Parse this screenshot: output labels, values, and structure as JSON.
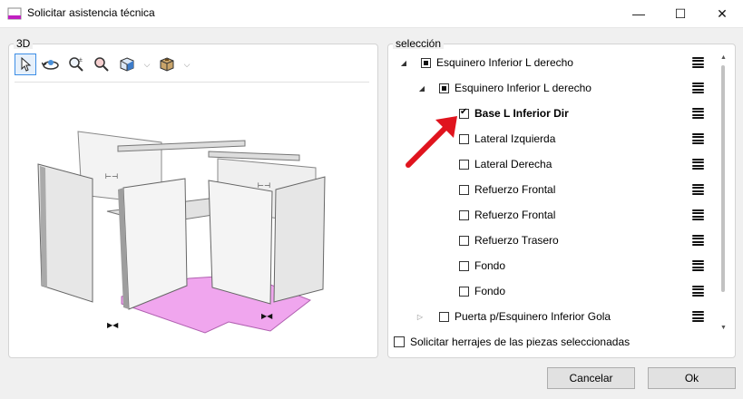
{
  "window": {
    "title": "Solicitar asistencia técnica",
    "minimize": "—",
    "maximize": "☐",
    "close": "✕"
  },
  "viewer": {
    "label": "3D",
    "tools": [
      "select-arrow-icon",
      "rotate-icon",
      "zoom-plus-minus-icon",
      "zoom-fit-icon",
      "view-cube-icon",
      "box-icon"
    ]
  },
  "selection": {
    "label": "selección",
    "items": [
      {
        "label": "Esquinero Inferior L derecho",
        "state": "indeterminate",
        "expander": "◢",
        "bold": false
      },
      {
        "label": "Esquinero Inferior L derecho",
        "state": "indeterminate",
        "expander": "◢",
        "bold": false
      },
      {
        "label": "Base L Inferior Dir",
        "state": "checked",
        "expander": "",
        "bold": true
      },
      {
        "label": "Lateral Izquierda",
        "state": "unchecked",
        "expander": "",
        "bold": false
      },
      {
        "label": "Lateral Derecha",
        "state": "unchecked",
        "expander": "",
        "bold": false
      },
      {
        "label": "Refuerzo Frontal",
        "state": "unchecked",
        "expander": "",
        "bold": false
      },
      {
        "label": "Refuerzo Frontal",
        "state": "unchecked",
        "expander": "",
        "bold": false
      },
      {
        "label": "Refuerzo Trasero",
        "state": "unchecked",
        "expander": "",
        "bold": false
      },
      {
        "label": "Fondo",
        "state": "unchecked",
        "expander": "",
        "bold": false
      },
      {
        "label": "Fondo",
        "state": "unchecked",
        "expander": "",
        "bold": false
      },
      {
        "label": "Puerta p/Esquinero Inferior Gola",
        "state": "unchecked",
        "expander": "▷",
        "bold": false
      }
    ],
    "hardware_label": "Solicitar herrajes de las piezas seleccionadas"
  },
  "buttons": {
    "cancel": "Cancelar",
    "ok": "Ok"
  },
  "colors": {
    "highlight_piece": "#f0a6ee",
    "arrow": "#e0141e",
    "accent": "#3d8ee6"
  }
}
